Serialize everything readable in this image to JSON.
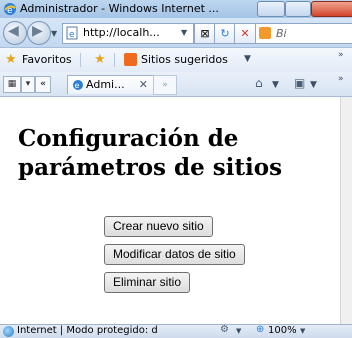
{
  "window": {
    "title": "Administrador - Windows Internet ..."
  },
  "nav": {
    "address": "http://localh...",
    "search_placeholder": "Bi"
  },
  "favorites": {
    "label": "Favoritos",
    "suggested": "Sitios sugeridos"
  },
  "tab": {
    "label": "Admi..."
  },
  "page": {
    "title": "Configuración de parámetros de sitios",
    "buttons": [
      "Crear nuevo sitio",
      "Modificar datos de sitio",
      "Eliminar sitio"
    ]
  },
  "status": {
    "zone": "Internet | Modo protegido: d",
    "zoom": "100%"
  }
}
